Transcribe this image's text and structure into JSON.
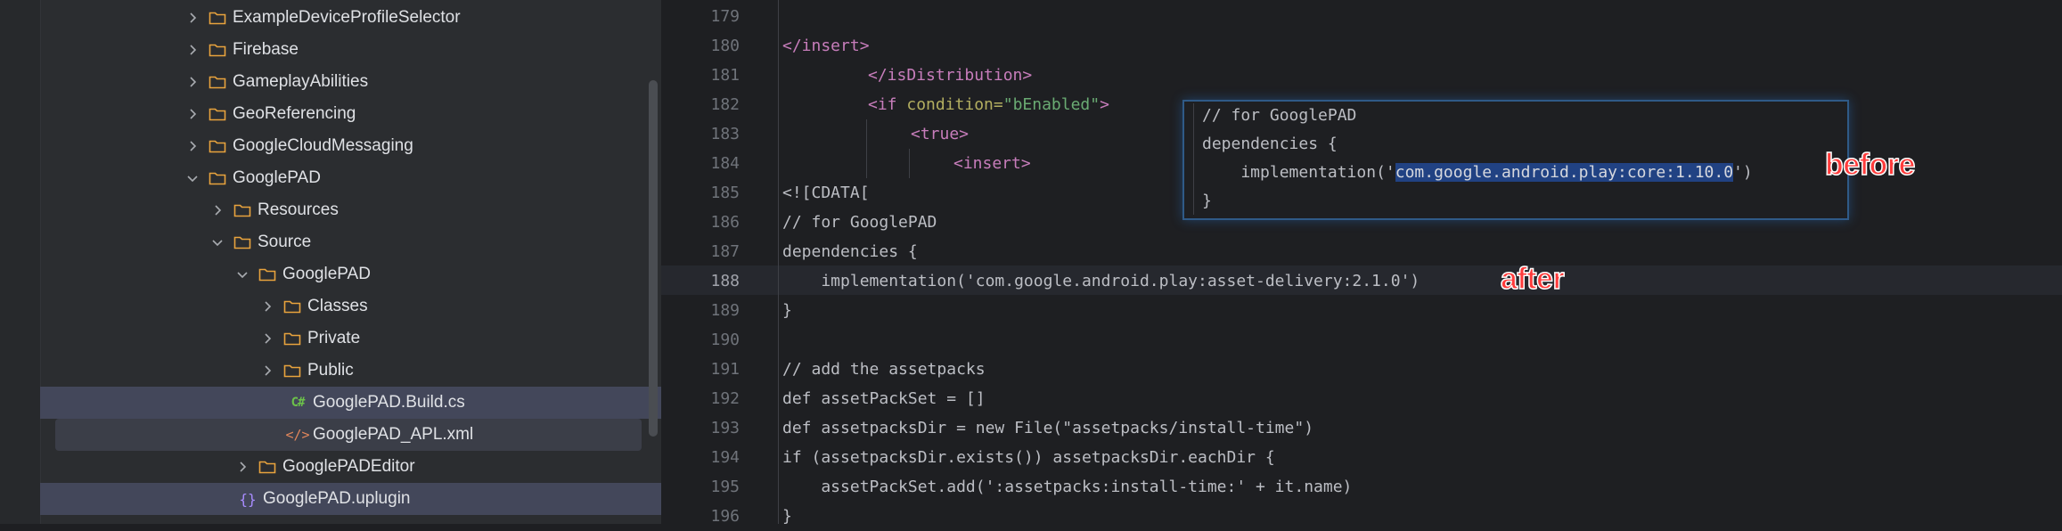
{
  "tree": {
    "items": [
      {
        "label": "ExampleDeviceProfileSelector",
        "icon": "folder-icon",
        "expanded": false
      },
      {
        "label": "Firebase",
        "icon": "folder-icon",
        "expanded": false
      },
      {
        "label": "GameplayAbilities",
        "icon": "folder-icon",
        "expanded": false
      },
      {
        "label": "GeoReferencing",
        "icon": "folder-icon",
        "expanded": false
      },
      {
        "label": "GoogleCloudMessaging",
        "icon": "folder-icon",
        "expanded": false
      },
      {
        "label": "GooglePAD",
        "icon": "folder-icon",
        "expanded": true
      },
      {
        "label": "Resources",
        "icon": "folder-icon",
        "expanded": false
      },
      {
        "label": "Source",
        "icon": "folder-icon",
        "expanded": true
      },
      {
        "label": "GooglePAD",
        "icon": "folder-icon",
        "expanded": true
      },
      {
        "label": "Classes",
        "icon": "folder-icon",
        "expanded": false
      },
      {
        "label": "Private",
        "icon": "folder-icon",
        "expanded": false
      },
      {
        "label": "Public",
        "icon": "folder-icon",
        "expanded": false
      },
      {
        "label": "GooglePAD.Build.cs",
        "icon": "csharp-file-icon"
      },
      {
        "label": "GooglePAD_APL.xml",
        "icon": "xml-file-icon"
      },
      {
        "label": "GooglePADEditor",
        "icon": "folder-icon",
        "expanded": false
      },
      {
        "label": "GooglePAD.uplugin",
        "icon": "json-file-icon"
      }
    ]
  },
  "editor": {
    "line_numbers": [
      "179",
      "180",
      "181",
      "182",
      "183",
      "184",
      "185",
      "186",
      "187",
      "188",
      "189",
      "190",
      "191",
      "192",
      "193",
      "194",
      "195",
      "196"
    ],
    "lines": {
      "l180": "</insert>",
      "l181": "</isDistribution>",
      "l182_tag": "<if ",
      "l182_attr": "condition=",
      "l182_val": "\"bEnabled\"",
      "l182_end": ">",
      "l183": "<true>",
      "l184": "<insert>",
      "l185": "<![CDATA[",
      "l186": "// for GooglePAD",
      "l187": "dependencies {",
      "l188": "    implementation('com.google.android.play:asset-delivery:2.1.0')",
      "l189": "}",
      "l191": "// add the assetpacks",
      "l192": "def assetPackSet = []",
      "l193": "def assetpacksDir = new File(\"assetpacks/install-time\")",
      "l194": "if (assetpacksDir.exists()) assetpacksDir.eachDir {",
      "l195": "    assetPackSet.add(':assetpacks:install-time:' + it.name)",
      "l196": "}"
    }
  },
  "popup": {
    "line1": "// for GooglePAD",
    "line2": "dependencies {",
    "line3_pre": "    implementation('",
    "line3_sel": "com.google.android.play:core:1.10.0",
    "line3_post": "')",
    "line4": "}"
  },
  "annotations": {
    "before": "before",
    "after": "after"
  }
}
